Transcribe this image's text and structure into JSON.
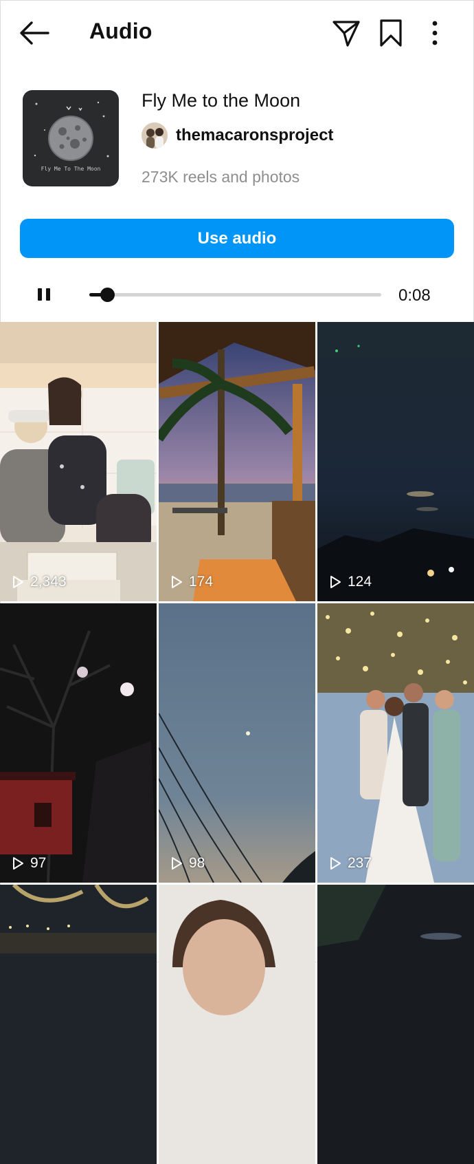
{
  "header": {
    "title": "Audio",
    "back_icon": "arrow-left-icon",
    "share_icon": "send-icon",
    "save_icon": "bookmark-icon",
    "more_icon": "more-vertical-icon"
  },
  "audio": {
    "title": "Fly Me to the Moon",
    "artist": "themacaronsproject",
    "count": "273K reels and photos",
    "cover_caption": "Fly Me To The Moon"
  },
  "actions": {
    "use_audio_label": "Use audio"
  },
  "player": {
    "state_icon": "pause-icon",
    "progress": 0.06,
    "time": "0:08"
  },
  "colors": {
    "accent": "#0095f6",
    "muted_text": "#8e8e8e"
  },
  "reels": [
    {
      "views": "2,343"
    },
    {
      "views": "174"
    },
    {
      "views": "124"
    },
    {
      "views": "97"
    },
    {
      "views": "98"
    },
    {
      "views": "237"
    },
    {
      "views": ""
    },
    {
      "views": ""
    },
    {
      "views": ""
    }
  ]
}
